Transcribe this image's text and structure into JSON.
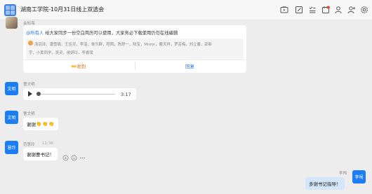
{
  "header": {
    "title": "湖南工学院-10月31日线上双选会"
  },
  "toolbar": [
    {
      "name": "live-icon"
    },
    {
      "name": "edit-icon"
    },
    {
      "name": "checklist-icon"
    },
    {
      "name": "calendar-icon"
    },
    {
      "name": "person-icon"
    },
    {
      "name": "add-member-icon"
    },
    {
      "name": "settings-icon"
    }
  ],
  "messages": {
    "notice": {
      "sender": "会知海",
      "mention": "@所有人",
      "text": "给大家同步一份空白简历可以使用，大家务必下载使用仍勿在线编辑",
      "recipients_line1": "汤润泽，潘雪娟，王佳灵，李淦，单乐群，程熙，陈舒一，陆宝，Mirror，戴天祥，罗芸梅，刘立馨，邵新",
      "recipients_line2": "宇，小黄同学，吴灵，侯妍玲，李睿璞",
      "collect_label": "收到",
      "reply_label": "回复"
    },
    "voice": {
      "avatar_text": "文明",
      "sender": "曹文明",
      "duration": "3:17"
    },
    "thanks": {
      "avatar_text": "文明",
      "sender": "曹文明",
      "text": "谢谢",
      "emoji": "👏👏👏"
    },
    "huiling": {
      "avatar_text": "慧玲",
      "sender": "范慧玲",
      "time": "11:36",
      "text": "谢谢曹书记！"
    },
    "mine": {
      "avatar_text": "李闯",
      "sender": "李闯",
      "text": "多谢书记指导！"
    }
  },
  "colors": {
    "avatar_blue": "#1d7ef3",
    "link_blue": "#2a6fd6",
    "my_bubble": "#d4e6fb",
    "background": "#ededed"
  }
}
